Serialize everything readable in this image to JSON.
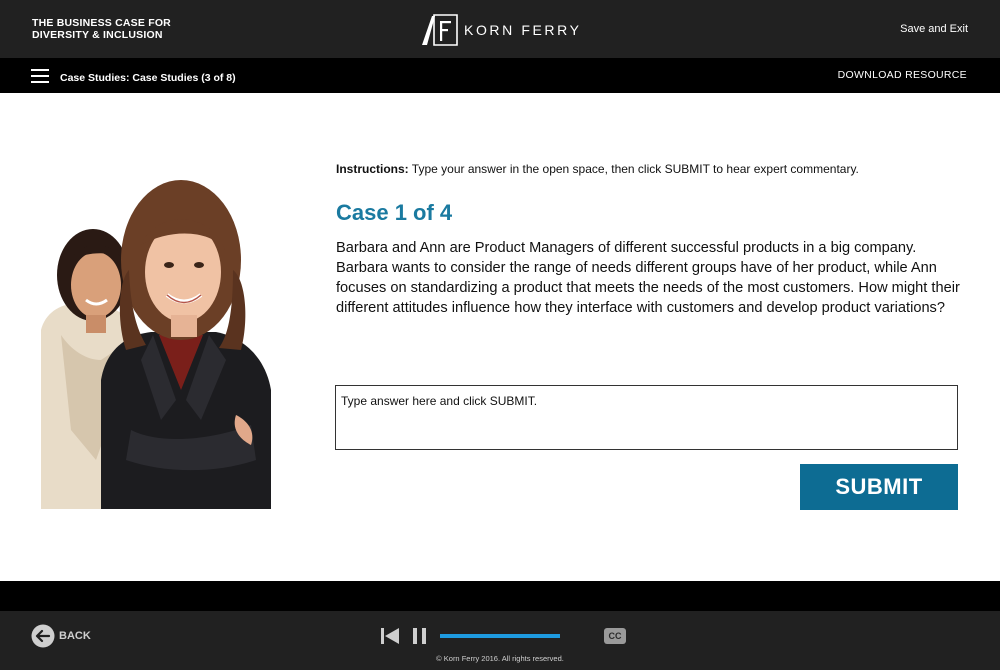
{
  "header": {
    "course_title_line1": "THE BUSINESS CASE FOR",
    "course_title_line2": "DIVERSITY & INCLUSION",
    "brand_name": "KORN FERRY",
    "save_exit_label": "Save and Exit"
  },
  "navbar": {
    "menu_icon": "hamburger-icon",
    "breadcrumb": "Case Studies: Case Studies (3 of 8)",
    "download_label": "DOWNLOAD RESOURCE"
  },
  "content": {
    "instructions_label": "Instructions:",
    "instructions_text": " Type your answer in the open space, then click SUBMIT to hear expert commentary.",
    "case_title": "Case 1 of 4",
    "case_text": "Barbara and Ann are Product Managers of different successful products in a big company. Barbara wants to consider the range of needs different groups have of her product, while Ann focuses on standardizing a product that meets the needs of the most customers. How might their different attitudes influence how they interface with customers and develop product variations?",
    "answer_placeholder": "Type answer here and click SUBMIT.",
    "answer_value": "",
    "submit_label": "SUBMIT"
  },
  "player": {
    "back_label": "BACK",
    "progress_fraction": 1.0,
    "cc_label": "CC",
    "copyright": "© Korn Ferry 2016. All rights reserved."
  },
  "colors": {
    "accent_blue": "#1a7aa0",
    "submit_bg": "#0d6c93",
    "progress_blue": "#1e9be0",
    "header_bg": "#212121",
    "nav_bg": "#000000"
  }
}
